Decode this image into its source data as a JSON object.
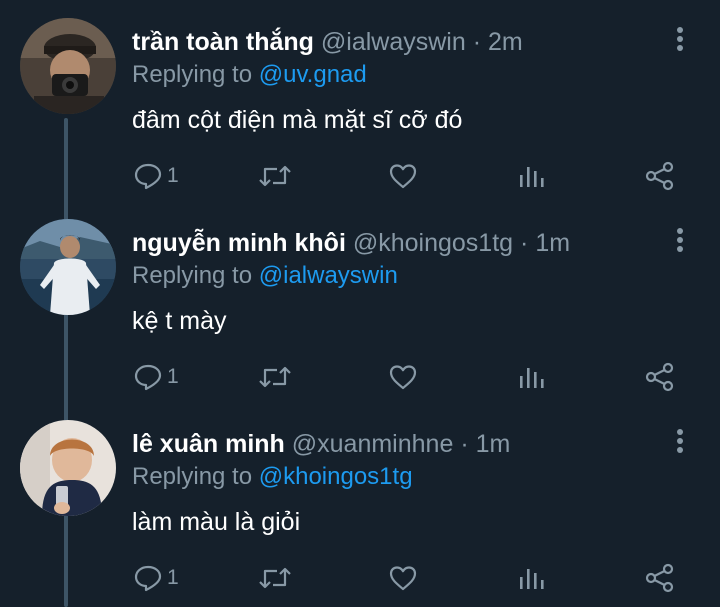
{
  "tweets": [
    {
      "name": "trần toàn thắng",
      "handle": "@ialwayswin",
      "separator": "·",
      "time": "2m",
      "replying_prefix": "Replying to",
      "replying_to": "@uv.gnad",
      "text": "đâm cột điện mà mặt sĩ cỡ đó",
      "reply_count": "1"
    },
    {
      "name": "nguyễn minh khôi",
      "handle": "@khoingos1tg",
      "separator": "·",
      "time": "1m",
      "replying_prefix": "Replying to",
      "replying_to": "@ialwayswin",
      "text": "kệ t mày",
      "reply_count": "1"
    },
    {
      "name": "lê xuân minh",
      "handle": "@xuanminhne",
      "separator": "·",
      "time": "1m",
      "replying_prefix": "Replying to",
      "replying_to": "@khoingos1tg",
      "text": "làm màu là giỏi",
      "reply_count": "1"
    }
  ],
  "icons": {
    "more": "more-vertical-icon",
    "reply": "reply-icon",
    "retweet": "retweet-icon",
    "like": "heart-icon",
    "analytics": "analytics-icon",
    "share": "share-icon"
  },
  "colors": {
    "background": "#15202b",
    "text": "#ffffff",
    "secondary": "#8899a6",
    "link": "#1d9bf0",
    "thread_line": "#3d5466"
  }
}
